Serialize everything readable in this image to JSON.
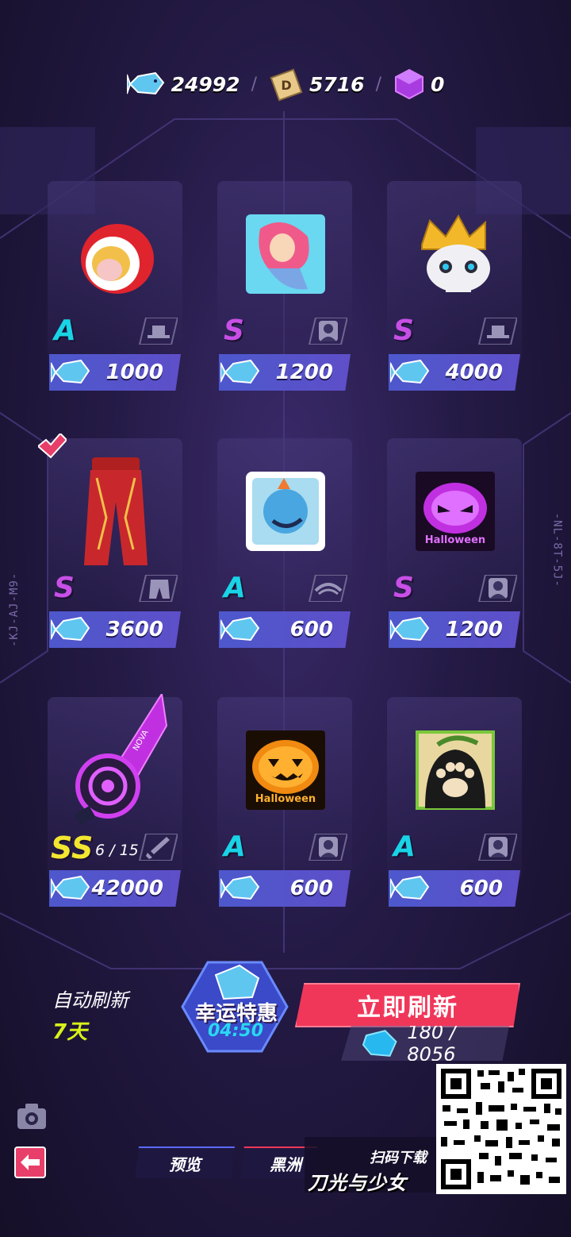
{
  "currencies": [
    {
      "icon": "fish-gem-icon",
      "value": "24992"
    },
    {
      "icon": "d-coin-icon",
      "value": "5716"
    },
    {
      "icon": "purple-cube-icon",
      "value": "0"
    }
  ],
  "separator": "/",
  "side_codes": {
    "left": "-KJ-AJ-M9-",
    "right": "-NL-8T-5J-"
  },
  "items": [
    {
      "rank": "A",
      "price": "1000",
      "type_icon": "hat-icon",
      "art": "fox-hood-icon"
    },
    {
      "rank": "S",
      "price": "1200",
      "type_icon": "avatar-icon",
      "art": "mermaid-portrait-icon"
    },
    {
      "rank": "S",
      "price": "4000",
      "type_icon": "hat-icon",
      "art": "crowned-skull-icon"
    },
    {
      "rank": "S",
      "price": "3600",
      "type_icon": "pants-icon",
      "art": "red-pants-icon",
      "owned": true
    },
    {
      "rank": "A",
      "price": "600",
      "type_icon": "eye-icon",
      "art": "blue-eye-badge-icon"
    },
    {
      "rank": "S",
      "price": "1200",
      "type_icon": "avatar-icon",
      "art": "halloween-mask-icon"
    },
    {
      "rank": "SS",
      "price": "42000",
      "type_icon": "sword-icon",
      "art": "nova-blade-icon",
      "count": "6 / 15"
    },
    {
      "rank": "A",
      "price": "600",
      "type_icon": "avatar-icon",
      "art": "halloween-pumpkin-icon"
    },
    {
      "rank": "A",
      "price": "600",
      "type_icon": "avatar-icon",
      "art": "cat-paw-icon"
    }
  ],
  "art_labels": {
    "halloween": "Halloween",
    "nova": "NOVA"
  },
  "bottom": {
    "auto_refresh_label": "自动刷新",
    "auto_refresh_days": "7天",
    "lucky_title": "幸运特惠",
    "lucky_timer": "04:50",
    "refresh_button": "立即刷新",
    "refresh_cost": "180 / 8056",
    "tab_preview": "预览",
    "tab_black": "黑洲",
    "promo_scan": "扫码下载",
    "promo_game": "刀光与少女"
  },
  "colors": {
    "rank_A": "#19d3e6",
    "rank_S": "#c74fe6",
    "rank_SS": "#f2e630",
    "refresh": "#f0375a",
    "price_bar": "#4d58cc"
  }
}
